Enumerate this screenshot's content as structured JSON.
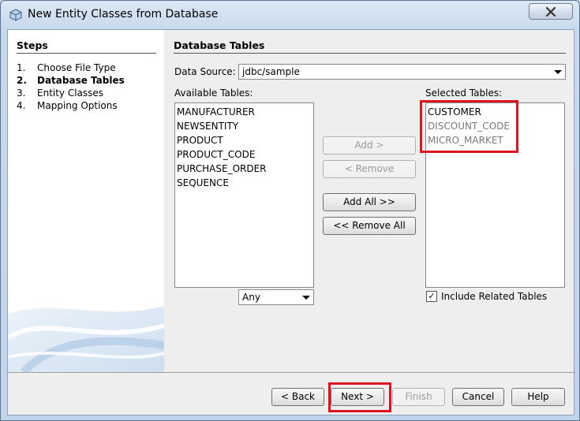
{
  "window": {
    "title": "New Entity Classes from Database",
    "close_icon": "close-icon"
  },
  "steps": {
    "heading": "Steps",
    "items": [
      {
        "num": "1.",
        "label": "Choose File Type"
      },
      {
        "num": "2.",
        "label": "Database Tables",
        "current": true
      },
      {
        "num": "3.",
        "label": "Entity Classes"
      },
      {
        "num": "4.",
        "label": "Mapping Options"
      }
    ]
  },
  "main": {
    "heading": "Database Tables",
    "data_source_label": "Data Source:",
    "data_source_value": "jdbc/sample",
    "available_label": "Available Tables:",
    "available_tables": [
      "MANUFACTURER",
      "NEWSENTITY",
      "PRODUCT",
      "PRODUCT_CODE",
      "PURCHASE_ORDER",
      "SEQUENCE"
    ],
    "filter_value": "Any",
    "selected_label": "Selected Tables:",
    "selected_tables": [
      {
        "name": "CUSTOMER",
        "dim": false
      },
      {
        "name": "DISCOUNT_CODE",
        "dim": true
      },
      {
        "name": "MICRO_MARKET",
        "dim": true
      }
    ],
    "add_label": "Add >",
    "remove_label": "< Remove",
    "add_all_label": "Add All >>",
    "remove_all_label": "<< Remove All",
    "include_related_label": "Include Related Tables",
    "include_related_checked": "✓"
  },
  "footer": {
    "back_label": "< Back",
    "next_label": "Next >",
    "finish_label": "Finish",
    "cancel_label": "Cancel",
    "help_label": "Help"
  },
  "highlight_color": "#e0141e"
}
